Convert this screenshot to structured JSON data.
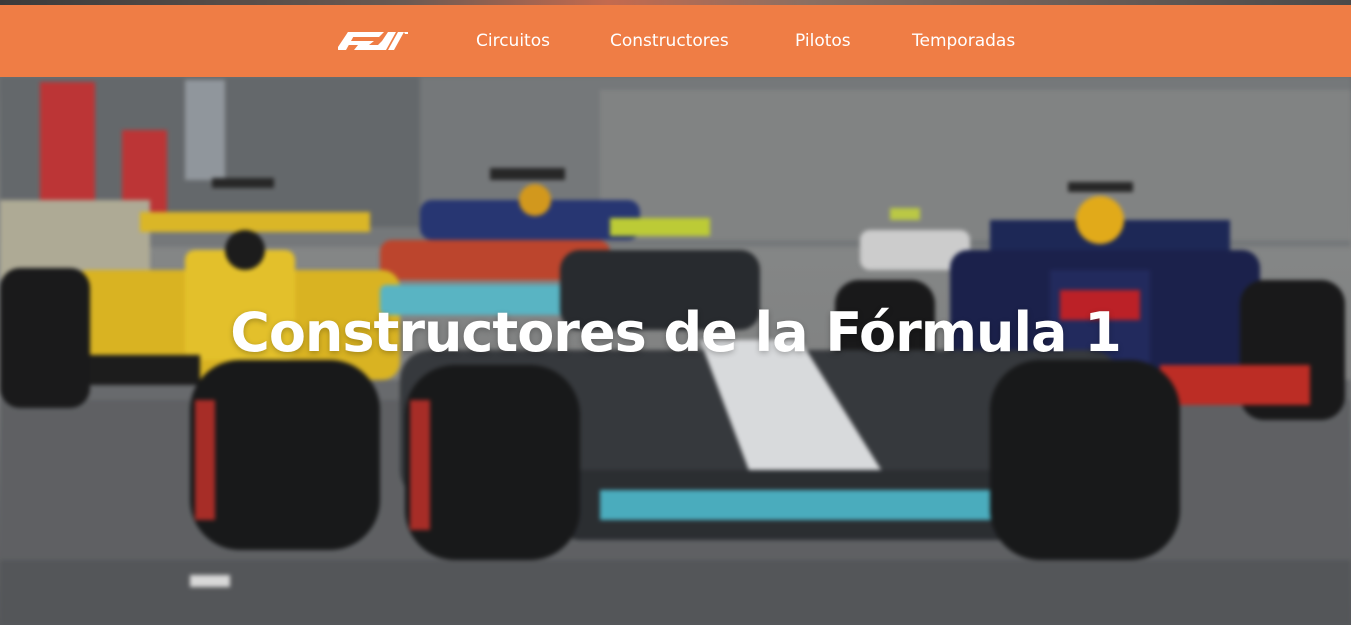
{
  "brand": {
    "logo": "f1-logo-icon",
    "nav_background": "#ef7d45",
    "text_color": "#ffffff"
  },
  "nav": {
    "items": [
      {
        "label": "Circuitos"
      },
      {
        "label": "Constructores"
      },
      {
        "label": "Pilotos"
      },
      {
        "label": "Temporadas"
      }
    ]
  },
  "hero": {
    "title": "Constructores de la Fórmula 1",
    "image": "blurred-f1-race-cars-photo"
  }
}
